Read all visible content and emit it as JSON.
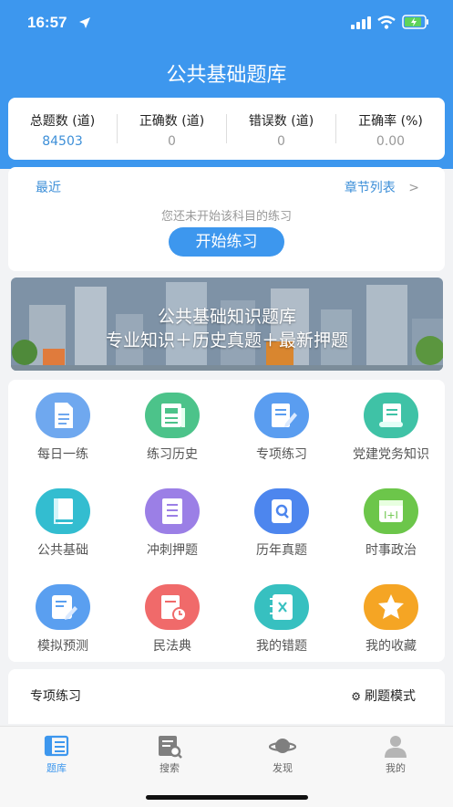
{
  "status_bar": {
    "time": "16:57"
  },
  "header": {
    "title": "公共基础题库"
  },
  "stats": [
    {
      "label": "总题数 (道)",
      "value": "84503"
    },
    {
      "label": "正确数 (道)",
      "value": "0"
    },
    {
      "label": "错误数 (道)",
      "value": "0"
    },
    {
      "label": "正确率 (%)",
      "value": "0.00"
    }
  ],
  "recent": {
    "left_label": "最近",
    "right_label": "章节列表",
    "message": "您还未开始该科目的练习",
    "start_button": "开始练习"
  },
  "banner": {
    "line1": "公共基础知识题库",
    "line2": "专业知识＋历史真题＋最新押题"
  },
  "grid": [
    {
      "label": "每日一练",
      "icon": "document-icon",
      "color": "#6fa8ef"
    },
    {
      "label": "练习历史",
      "icon": "newspaper-icon",
      "color": "#4cc38a"
    },
    {
      "label": "专项练习",
      "icon": "notes-icon",
      "color": "#5a9df0"
    },
    {
      "label": "党建党务知识",
      "icon": "scroll-icon",
      "color": "#3fc2a6"
    },
    {
      "label": "公共基础",
      "icon": "book-icon",
      "color": "#33bdd0"
    },
    {
      "label": "冲刺押题",
      "icon": "list-icon",
      "color": "#9b7fe6"
    },
    {
      "label": "历年真题",
      "icon": "search-doc-icon",
      "color": "#4d86ee"
    },
    {
      "label": "时事政治",
      "icon": "calendar-icon",
      "color": "#6cc64a"
    },
    {
      "label": "模拟预测",
      "icon": "edit-icon",
      "color": "#5a9ff0"
    },
    {
      "label": "民法典",
      "icon": "clock-doc-icon",
      "color": "#f06a6a"
    },
    {
      "label": "我的错题",
      "icon": "wrong-notebook-icon",
      "color": "#37c0c0"
    },
    {
      "label": "我的收藏",
      "icon": "star-icon",
      "color": "#f5a524"
    }
  ],
  "special": {
    "title": "专项练习",
    "mode": "刷题模式"
  },
  "tabbar": [
    {
      "label": "题库",
      "icon": "library-icon"
    },
    {
      "label": "搜索",
      "icon": "search-icon"
    },
    {
      "label": "发现",
      "icon": "planet-icon"
    },
    {
      "label": "我的",
      "icon": "user-icon"
    }
  ],
  "colors": {
    "primary": "#3d97ee",
    "accent_text": "#3d8fd8"
  }
}
